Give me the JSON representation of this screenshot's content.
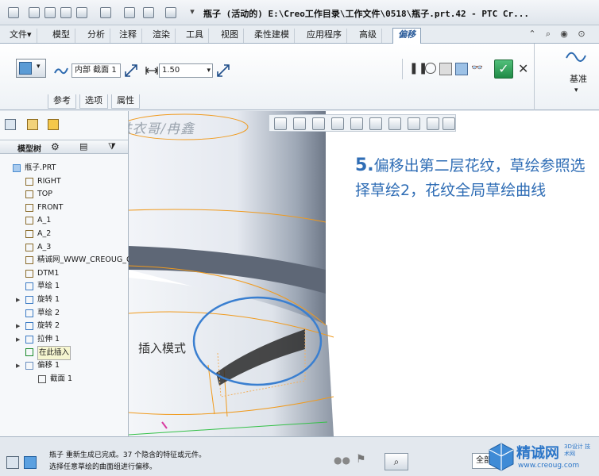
{
  "window": {
    "title": "瓶子 (活动的) E:\\Creo工作目录\\工作文件\\0518\\瓶子.prt.42 - PTC Cr..."
  },
  "menu": {
    "tabs": [
      "文件▾",
      "模型",
      "分析",
      "注释",
      "渲染",
      "工具",
      "视图",
      "柔性建模",
      "应用程序",
      "高级",
      "偏移"
    ],
    "active_tab": "偏移"
  },
  "ribbon": {
    "section_label": "内部 截面 1",
    "offset_value": "1.50",
    "datum_label": "基准",
    "subtabs": [
      "参考",
      "选项",
      "属性"
    ]
  },
  "watermark_text": "精诚网 铁衣哥/冉鑫",
  "model_tree": {
    "header": "模型树",
    "items": [
      {
        "label": "瓶子.PRT",
        "icon": "part-icon",
        "expand": false,
        "indent": 0
      },
      {
        "label": "RIGHT",
        "icon": "datum-plane-icon",
        "expand": false,
        "indent": 1
      },
      {
        "label": "TOP",
        "icon": "datum-plane-icon",
        "expand": false,
        "indent": 1
      },
      {
        "label": "FRONT",
        "icon": "datum-plane-icon",
        "expand": false,
        "indent": 1
      },
      {
        "label": "A_1",
        "icon": "datum-axis-icon",
        "expand": false,
        "indent": 1
      },
      {
        "label": "A_2",
        "icon": "datum-axis-icon",
        "expand": false,
        "indent": 1
      },
      {
        "label": "A_3",
        "icon": "datum-axis-icon",
        "expand": false,
        "indent": 1
      },
      {
        "label": "精诚网_WWW_CREOUG_C",
        "icon": "coordinate-system-icon",
        "expand": false,
        "indent": 1
      },
      {
        "label": "DTM1",
        "icon": "datum-plane-icon",
        "expand": false,
        "indent": 1
      },
      {
        "label": "草绘 1",
        "icon": "sketch-icon",
        "expand": false,
        "indent": 1
      },
      {
        "label": "旋转 1",
        "icon": "revolve-icon",
        "expand": true,
        "indent": 1
      },
      {
        "label": "草绘 2",
        "icon": "sketch-icon",
        "expand": false,
        "indent": 1
      },
      {
        "label": "旋转 2",
        "icon": "revolve-icon",
        "expand": true,
        "indent": 1
      },
      {
        "label": "拉伸 1",
        "icon": "extrude-icon",
        "expand": true,
        "indent": 1
      },
      {
        "label": "在此插入",
        "icon": "insert-arrow-icon",
        "expand": false,
        "indent": 1
      },
      {
        "label": "偏移 1",
        "icon": "offset-icon",
        "expand": true,
        "indent": 1
      },
      {
        "label": "截面 1",
        "icon": "section-icon",
        "expand": false,
        "indent": 2
      }
    ]
  },
  "canvas": {
    "insert_mode_label": "插入模式"
  },
  "annotation": {
    "step": "5.",
    "text": "偏移出第二层花纹，草绘参照选择草绘2，花纹全局草绘曲线"
  },
  "status": {
    "line1": "瓶子 重新生成已完成。37 个隐含的特征或元件。",
    "line2": "选择任意草绘的曲面组进行偏移。",
    "filter": "全部",
    "logo_text": "精诚网",
    "logo_url": "www.creoug.com",
    "logo_badge": "3D设计 技术网"
  },
  "colors": {
    "accent": "#2f6db5",
    "orange_edge": "#f09a1d",
    "blue_circle": "#3a7fd0"
  }
}
